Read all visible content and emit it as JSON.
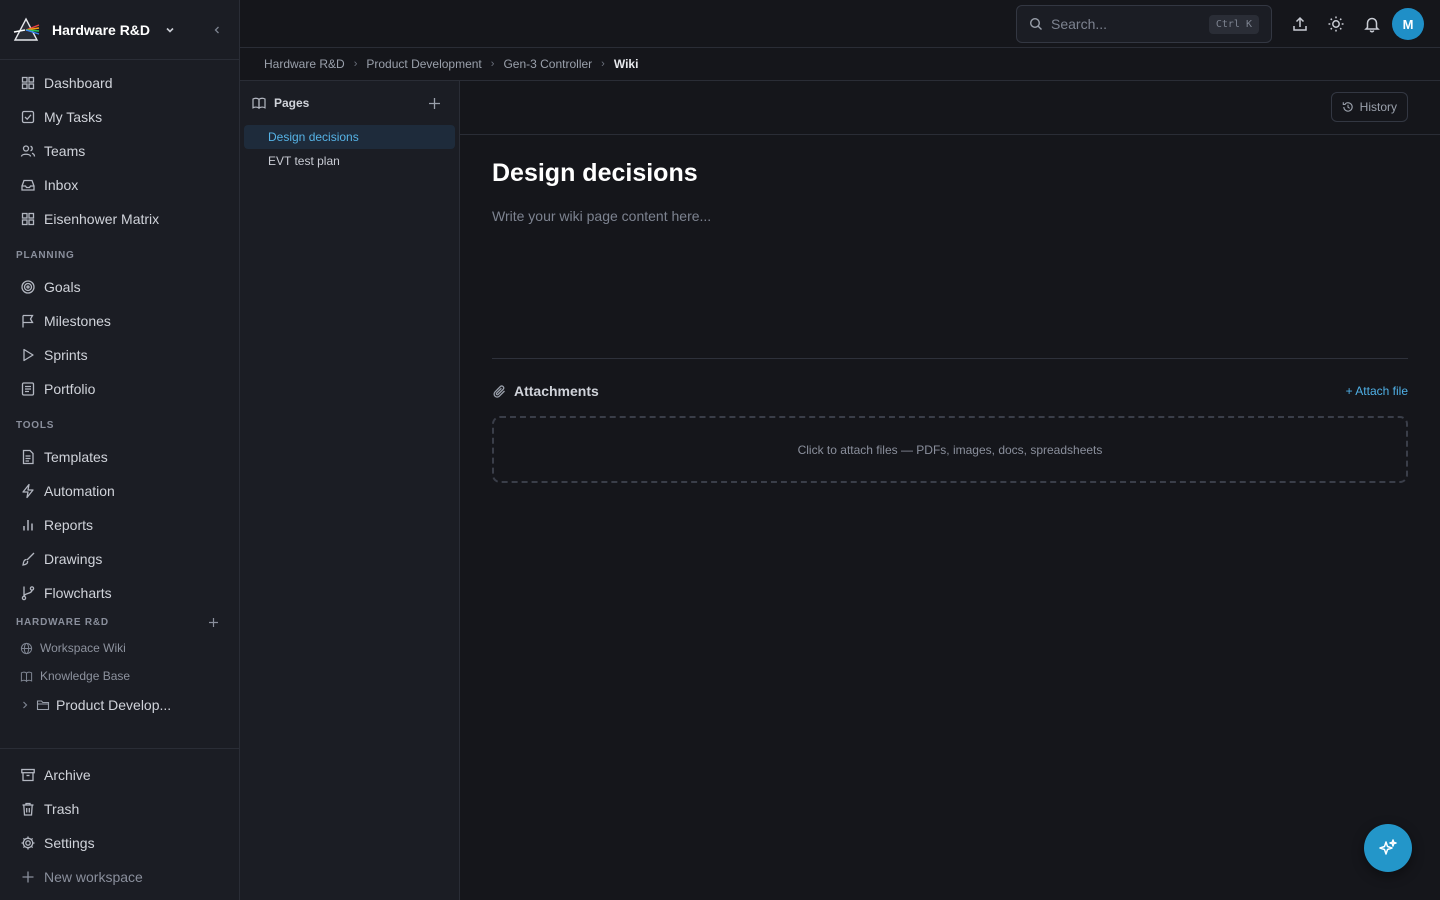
{
  "workspace": {
    "name": "Hardware R&D"
  },
  "nav": {
    "main": [
      {
        "label": "Dashboard",
        "icon": "dashboard-icon"
      },
      {
        "label": "My Tasks",
        "icon": "check-square-icon"
      },
      {
        "label": "Teams",
        "icon": "users-icon"
      },
      {
        "label": "Inbox",
        "icon": "inbox-icon"
      },
      {
        "label": "Eisenhower Matrix",
        "icon": "grid-icon"
      }
    ],
    "planning_label": "PLANNING",
    "planning": [
      {
        "label": "Goals",
        "icon": "target-icon"
      },
      {
        "label": "Milestones",
        "icon": "flag-icon"
      },
      {
        "label": "Sprints",
        "icon": "play-icon"
      },
      {
        "label": "Portfolio",
        "icon": "portfolio-icon"
      }
    ],
    "tools_label": "TOOLS",
    "tools": [
      {
        "label": "Templates",
        "icon": "file-text-icon"
      },
      {
        "label": "Automation",
        "icon": "zap-icon"
      },
      {
        "label": "Reports",
        "icon": "bar-chart-icon"
      },
      {
        "label": "Drawings",
        "icon": "brush-icon"
      },
      {
        "label": "Flowcharts",
        "icon": "git-branch-icon"
      }
    ],
    "workspace_label": "HARDWARE R&D",
    "workspace_items": [
      {
        "label": "Workspace Wiki",
        "icon": "globe-icon"
      },
      {
        "label": "Knowledge Base",
        "icon": "book-icon"
      }
    ],
    "tree_item": "Product Develop...",
    "bottom": [
      {
        "label": "Archive",
        "icon": "archive-icon"
      },
      {
        "label": "Trash",
        "icon": "trash-icon"
      },
      {
        "label": "Settings",
        "icon": "gear-icon"
      },
      {
        "label": "New workspace",
        "icon": "plus-icon"
      }
    ]
  },
  "topbar": {
    "search_placeholder": "Search...",
    "search_shortcut": "Ctrl K",
    "avatar_initial": "M"
  },
  "breadcrumb": [
    "Hardware R&D",
    "Product Development",
    "Gen-3 Controller",
    "Wiki"
  ],
  "pages": {
    "title": "Pages",
    "items": [
      "Design decisions",
      "EVT test plan"
    ],
    "active_index": 0
  },
  "content": {
    "history_label": "History",
    "title": "Design decisions",
    "placeholder": "Write your wiki page content here...",
    "attachments_title": "Attachments",
    "attach_link": "+ Attach file",
    "dropzone_text": "Click to attach files — PDFs, images, docs, spreadsheets"
  },
  "colors": {
    "accent": "#2396c9",
    "background": "#15161b",
    "sidebar": "#1b1d24",
    "active_page_bg": "#1e2b3b",
    "active_page_text": "#56b3e6"
  }
}
